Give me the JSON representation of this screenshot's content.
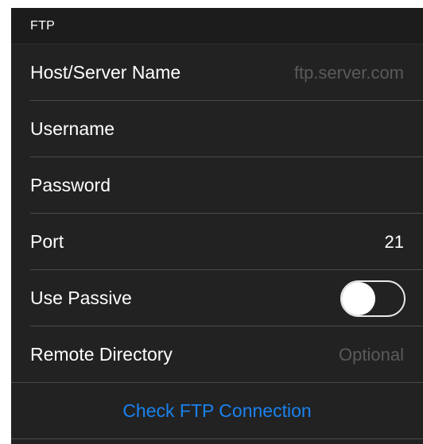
{
  "section": {
    "title": "FTP"
  },
  "fields": {
    "host": {
      "label": "Host/Server Name",
      "value": "",
      "placeholder": "ftp.server.com"
    },
    "username": {
      "label": "Username",
      "value": "",
      "placeholder": ""
    },
    "password": {
      "label": "Password",
      "value": "",
      "placeholder": ""
    },
    "port": {
      "label": "Port",
      "value": "21",
      "placeholder": ""
    },
    "passive": {
      "label": "Use Passive",
      "enabled": false
    },
    "remote_dir": {
      "label": "Remote Directory",
      "value": "",
      "placeholder": "Optional"
    }
  },
  "actions": {
    "check_connection": "Check FTP Connection"
  },
  "colors": {
    "background": "#222222",
    "header_background": "#1c1c1c",
    "separator": "#4a4a4a",
    "label": "#ffffff",
    "placeholder": "#5a5a5a",
    "accent": "#1a82f0"
  }
}
